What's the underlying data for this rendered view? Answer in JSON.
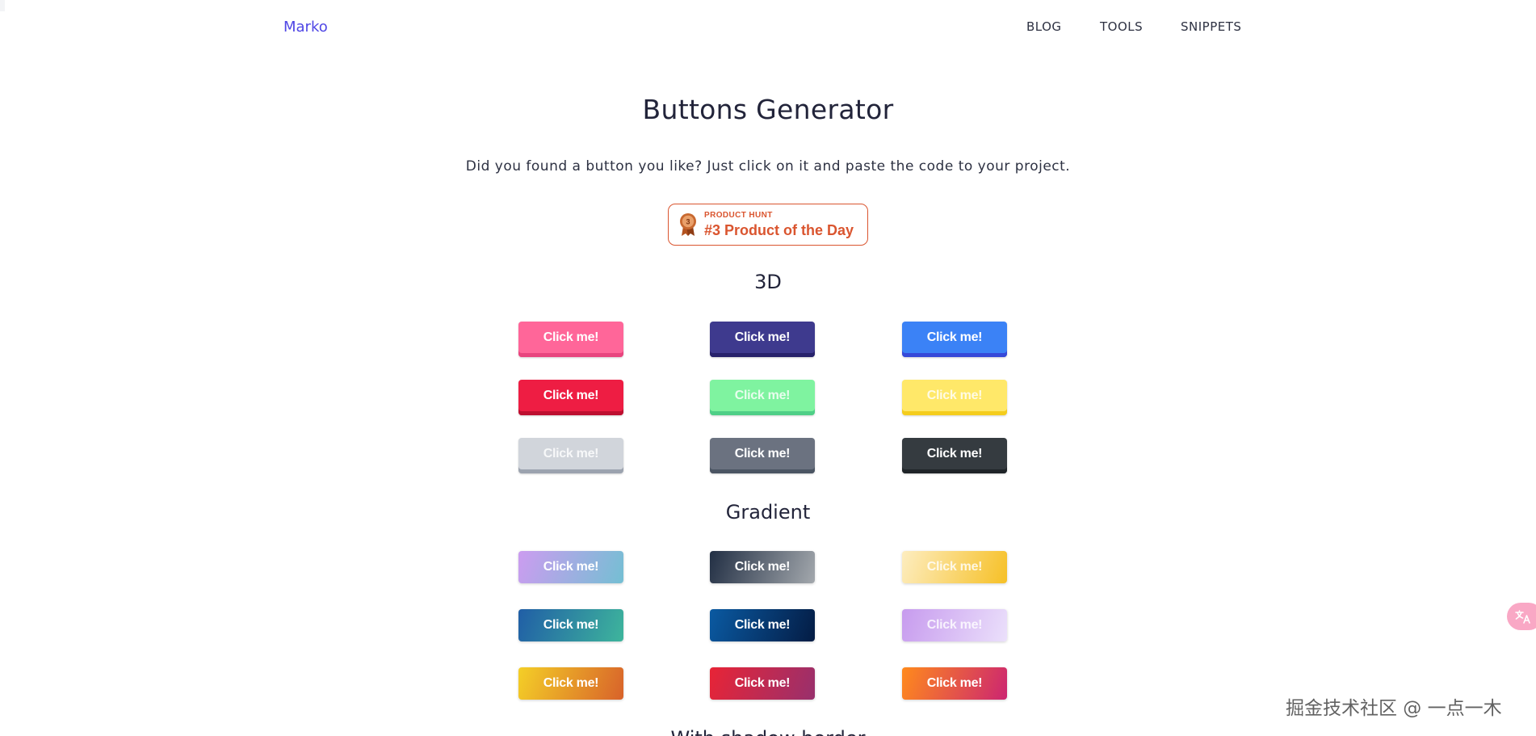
{
  "header": {
    "brand": "Marko",
    "nav": [
      {
        "label": "BLOG"
      },
      {
        "label": "TOOLS"
      },
      {
        "label": "SNIPPETS"
      }
    ]
  },
  "hero": {
    "title": "Buttons Generator",
    "subtitle": "Did you found a button you like? Just click on it and paste the code to your project."
  },
  "product_hunt": {
    "kicker": "PRODUCT HUNT",
    "label": "#3 Product of the Day",
    "rank": "3",
    "color": "#da552f"
  },
  "sections": {
    "three_d": {
      "title": "3D",
      "buttons": [
        {
          "label": "Click me!",
          "bg": "#ff6699",
          "edge": "#e8457e"
        },
        {
          "label": "Click me!",
          "bg": "#3e3a8e",
          "edge": "#27226b"
        },
        {
          "label": "Click me!",
          "bg": "#3b82f6",
          "edge": "#3649d8"
        },
        {
          "label": "Click me!",
          "bg": "#ee1d43",
          "edge": "#bd0f30"
        },
        {
          "label": "Click me!",
          "bg": "#7ff3a0",
          "edge": "#4fcf87"
        },
        {
          "label": "Click me!",
          "bg": "#ffe869",
          "edge": "#f4cd1d"
        },
        {
          "label": "Click me!",
          "bg": "#d1d5db",
          "edge": "#9ca3af"
        },
        {
          "label": "Click me!",
          "bg": "#6b7280",
          "edge": "#4b5563"
        },
        {
          "label": "Click me!",
          "bg": "#353b40",
          "edge": "#1f2428"
        }
      ]
    },
    "gradient": {
      "title": "Gradient",
      "buttons": [
        {
          "label": "Click me!",
          "from": "#cc9cf0",
          "to": "#74bfd3"
        },
        {
          "label": "Click me!",
          "from": "#222f44",
          "to": "#a3a8ad"
        },
        {
          "label": "Click me!",
          "from": "#fdedc0",
          "to": "#f6c026"
        },
        {
          "label": "Click me!",
          "from": "#205ea6",
          "to": "#3eb59c"
        },
        {
          "label": "Click me!",
          "from": "#0a5aa2",
          "to": "#041c44"
        },
        {
          "label": "Click me!",
          "from": "#c79bee",
          "to": "#ebe0fb"
        },
        {
          "label": "Click me!",
          "from": "#f4cf27",
          "to": "#d8622a"
        },
        {
          "label": "Click me!",
          "from": "#e82436",
          "to": "#98306d"
        },
        {
          "label": "Click me!",
          "from": "#ff8a1c",
          "to": "#cc2571"
        }
      ]
    },
    "next": {
      "title": "With shadow border"
    }
  },
  "overlay": {
    "watermark": "掘金技术社区 @ 一点一木",
    "translate_icon": "translate-icon"
  }
}
